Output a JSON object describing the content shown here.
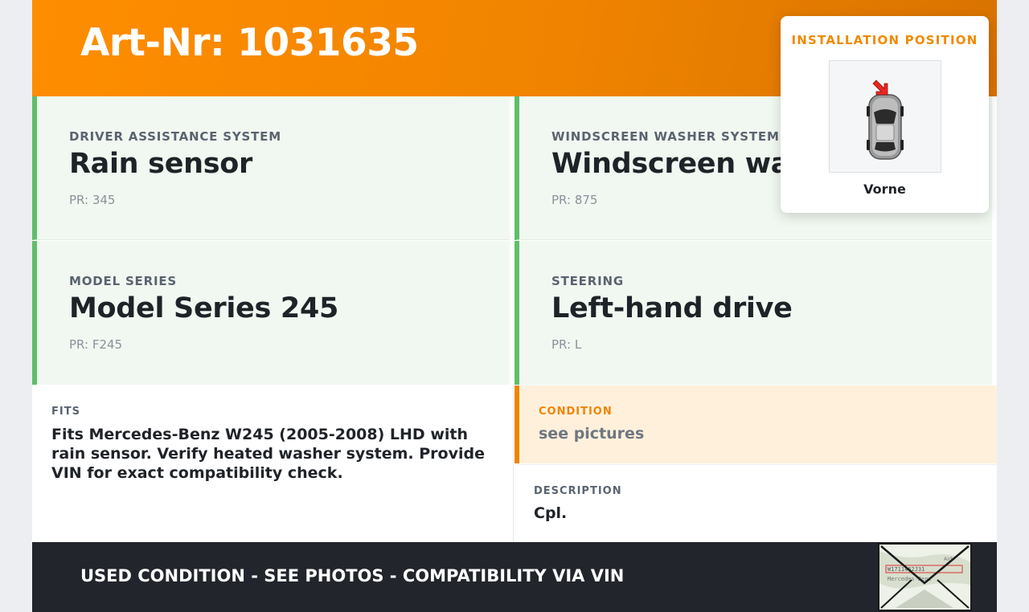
{
  "header": {
    "title": "Art-Nr: 1031635"
  },
  "specs": [
    {
      "label": "DRIVER ASSISTANCE SYSTEM",
      "value": "Rain sensor",
      "pr": "PR: 345"
    },
    {
      "label": "WINDSCREEN WASHER SYSTEM",
      "value": "Windscreen washer system",
      "pr": "PR: 875"
    },
    {
      "label": "MODEL SERIES",
      "value": "Model Series 245",
      "pr": "PR: F245"
    },
    {
      "label": "STEERING",
      "value": "Left-hand drive",
      "pr": "PR: L"
    }
  ],
  "fits": {
    "label": "FITS",
    "text": "Fits Mercedes-Benz W245 (2005-2008) LHD with rain sensor. Verify heated washer system. Provide VIN for exact compatibility check."
  },
  "condition": {
    "label": "CONDITION",
    "value": "see pictures"
  },
  "description": {
    "label": "DESCRIPTION",
    "value": "Cpl."
  },
  "footer": {
    "text": "USED CONDITION - SEE PHOTOS - COMPATIBILITY VIA VIN",
    "vin_image_text": "W1711462J31... Mercedes-Benz"
  },
  "installation": {
    "title": "INSTALLATION POSITION",
    "caption": "Vorne",
    "image_icon": "car-top-view-front-arrow-icon"
  },
  "colors": {
    "accent_orange": "#f08400",
    "spec_green": "#5fbf6a",
    "footer_dark": "#22252b"
  }
}
